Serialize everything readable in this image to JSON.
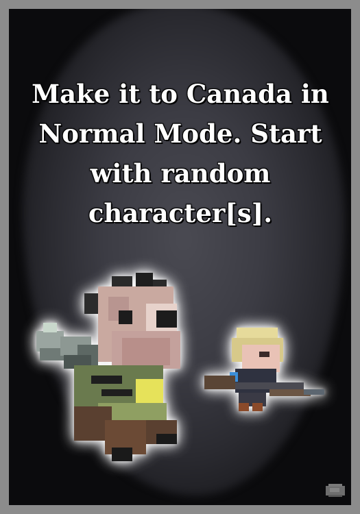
{
  "card": {
    "objective_text": "Make it to Canada in Normal Mode. Start with random character[s]."
  },
  "characters": [
    {
      "name": "bearded-survivor",
      "weapon": "chainsaw"
    },
    {
      "name": "blonde-survivor",
      "weapon": "rifle"
    }
  ],
  "icons": {
    "corner": "rock-icon"
  },
  "colors": {
    "frame": "#8c8c8c",
    "card_bg": "#0b0b0d",
    "glow": "#4a4a52",
    "text": "#ffffff"
  }
}
